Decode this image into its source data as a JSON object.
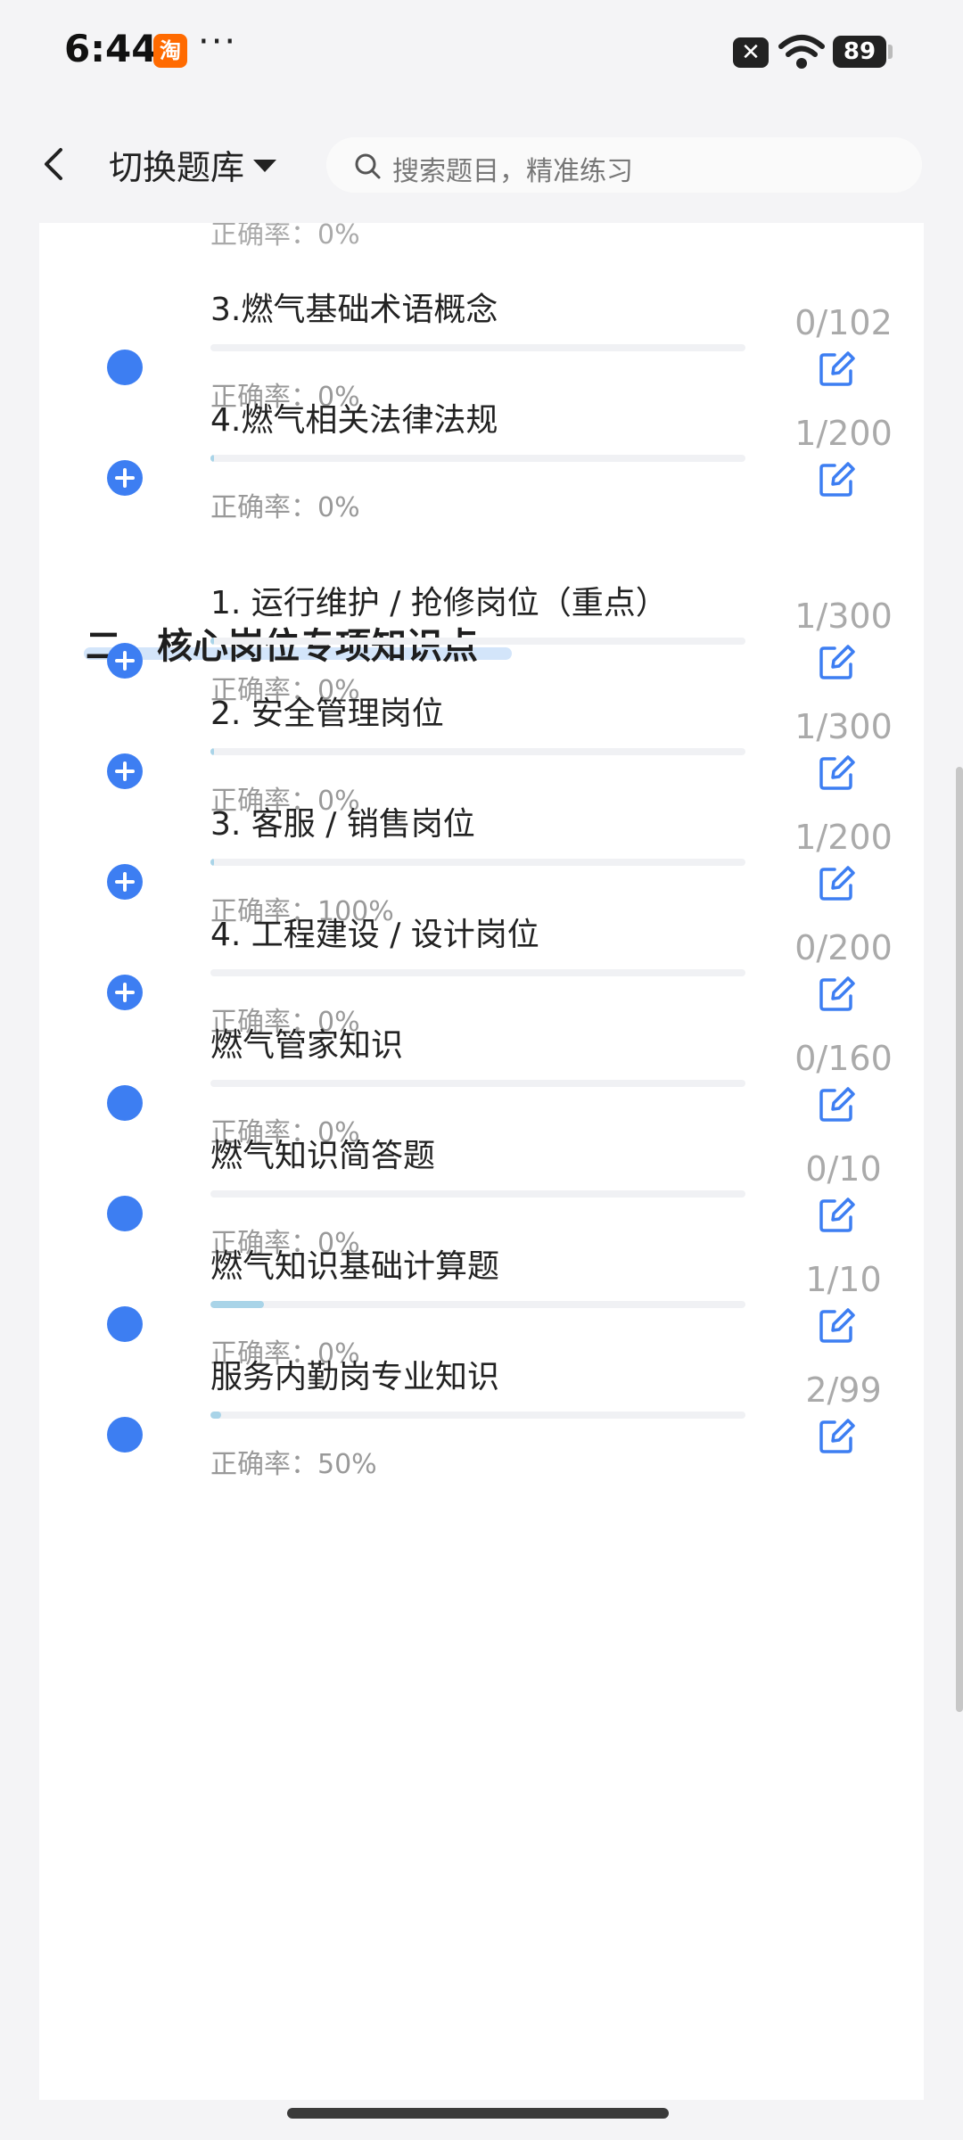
{
  "status_bar": {
    "time": "6:44",
    "taobao_label": "淘",
    "battery": "89"
  },
  "header": {
    "bank_switch_label": "切换题库",
    "search_placeholder": "搜索题目，精准练习"
  },
  "cut_top_text": "正确率：0%",
  "section2_title": "二、核心岗位专项知识点",
  "accuracy_prefix": "正确率：",
  "rows": [
    {
      "title": "3.燃气基础术语概念",
      "accuracy": "正确率：0%",
      "count": "0/102",
      "progress": 0,
      "expandable": false
    },
    {
      "title": "4.燃气相关法律法规",
      "accuracy": "正确率：0%",
      "count": "1/200",
      "progress": 0.005,
      "expandable": true
    },
    {
      "title": "1. 运行维护 / 抢修岗位（重点）",
      "accuracy": "正确率：0%",
      "count": "1/300",
      "progress": 0.0033,
      "expandable": true
    },
    {
      "title": "2. 安全管理岗位",
      "accuracy": "正确率：0%",
      "count": "1/300",
      "progress": 0.0033,
      "expandable": true
    },
    {
      "title": "3. 客服 / 销售岗位",
      "accuracy": "正确率：100%",
      "count": "1/200",
      "progress": 0.005,
      "expandable": true
    },
    {
      "title": "4. 工程建设 / 设计岗位",
      "accuracy": "正确率：0%",
      "count": "0/200",
      "progress": 0,
      "expandable": true
    },
    {
      "title": "燃气管家知识",
      "accuracy": "正确率：0%",
      "count": "0/160",
      "progress": 0,
      "expandable": false
    },
    {
      "title": "燃气知识简答题",
      "accuracy": "正确率：0%",
      "count": "0/10",
      "progress": 0,
      "expandable": false
    },
    {
      "title": "燃气知识基础计算题",
      "accuracy": "正确率：0%",
      "count": "1/10",
      "progress": 0.1,
      "expandable": false
    },
    {
      "title": "服务内勤岗专业知识",
      "accuracy": "正确率：50%",
      "count": "2/99",
      "progress": 0.02,
      "expandable": false
    }
  ],
  "colors": {
    "accent": "#3d7ef2",
    "progress_fill": "#a9d4e8",
    "muted": "#aaa"
  }
}
